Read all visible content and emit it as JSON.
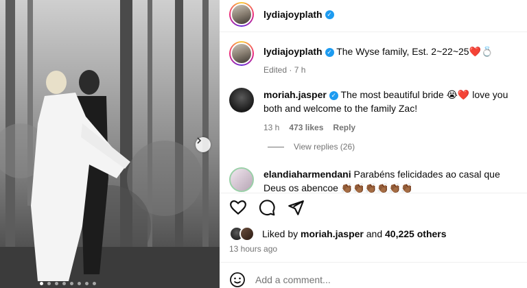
{
  "post": {
    "author": "lydiajoyplath",
    "images_count": 8,
    "active_image": 0
  },
  "caption": {
    "username": "lydiajoyplath",
    "text": "The Wyse family, Est. 2~22~25",
    "emoji": "❤️💍",
    "meta": "Edited · 7 h"
  },
  "comments": [
    {
      "username": "moriah.jasper",
      "verified": true,
      "text": "The most beautiful bride 😭❤️ love you both and welcome to the family Zac!",
      "time": "13 h",
      "likes": "473 likes",
      "reply_label": "Reply"
    },
    {
      "username": "elandiaharmendani",
      "verified": false,
      "text": "Parabéns felicidades ao casal que Deus os abencoe 👏🏾👏🏾👏🏾👏🏾👏🏾👏🏾"
    }
  ],
  "view_replies": "View replies (26)",
  "likes": {
    "prefix": "Liked by",
    "user": "moriah.jasper",
    "joiner": "and",
    "others": "40,225 others"
  },
  "timestamp": "13 hours ago",
  "add_comment_placeholder": "Add a comment...",
  "colors": {
    "verified": "#1d9bf0",
    "secondary_text": "#737373",
    "heart": "#e0245e"
  },
  "icons": [
    "heart-icon",
    "comment-icon",
    "share-icon",
    "smiley-icon",
    "chevron-right-icon",
    "verified-badge-icon"
  ]
}
